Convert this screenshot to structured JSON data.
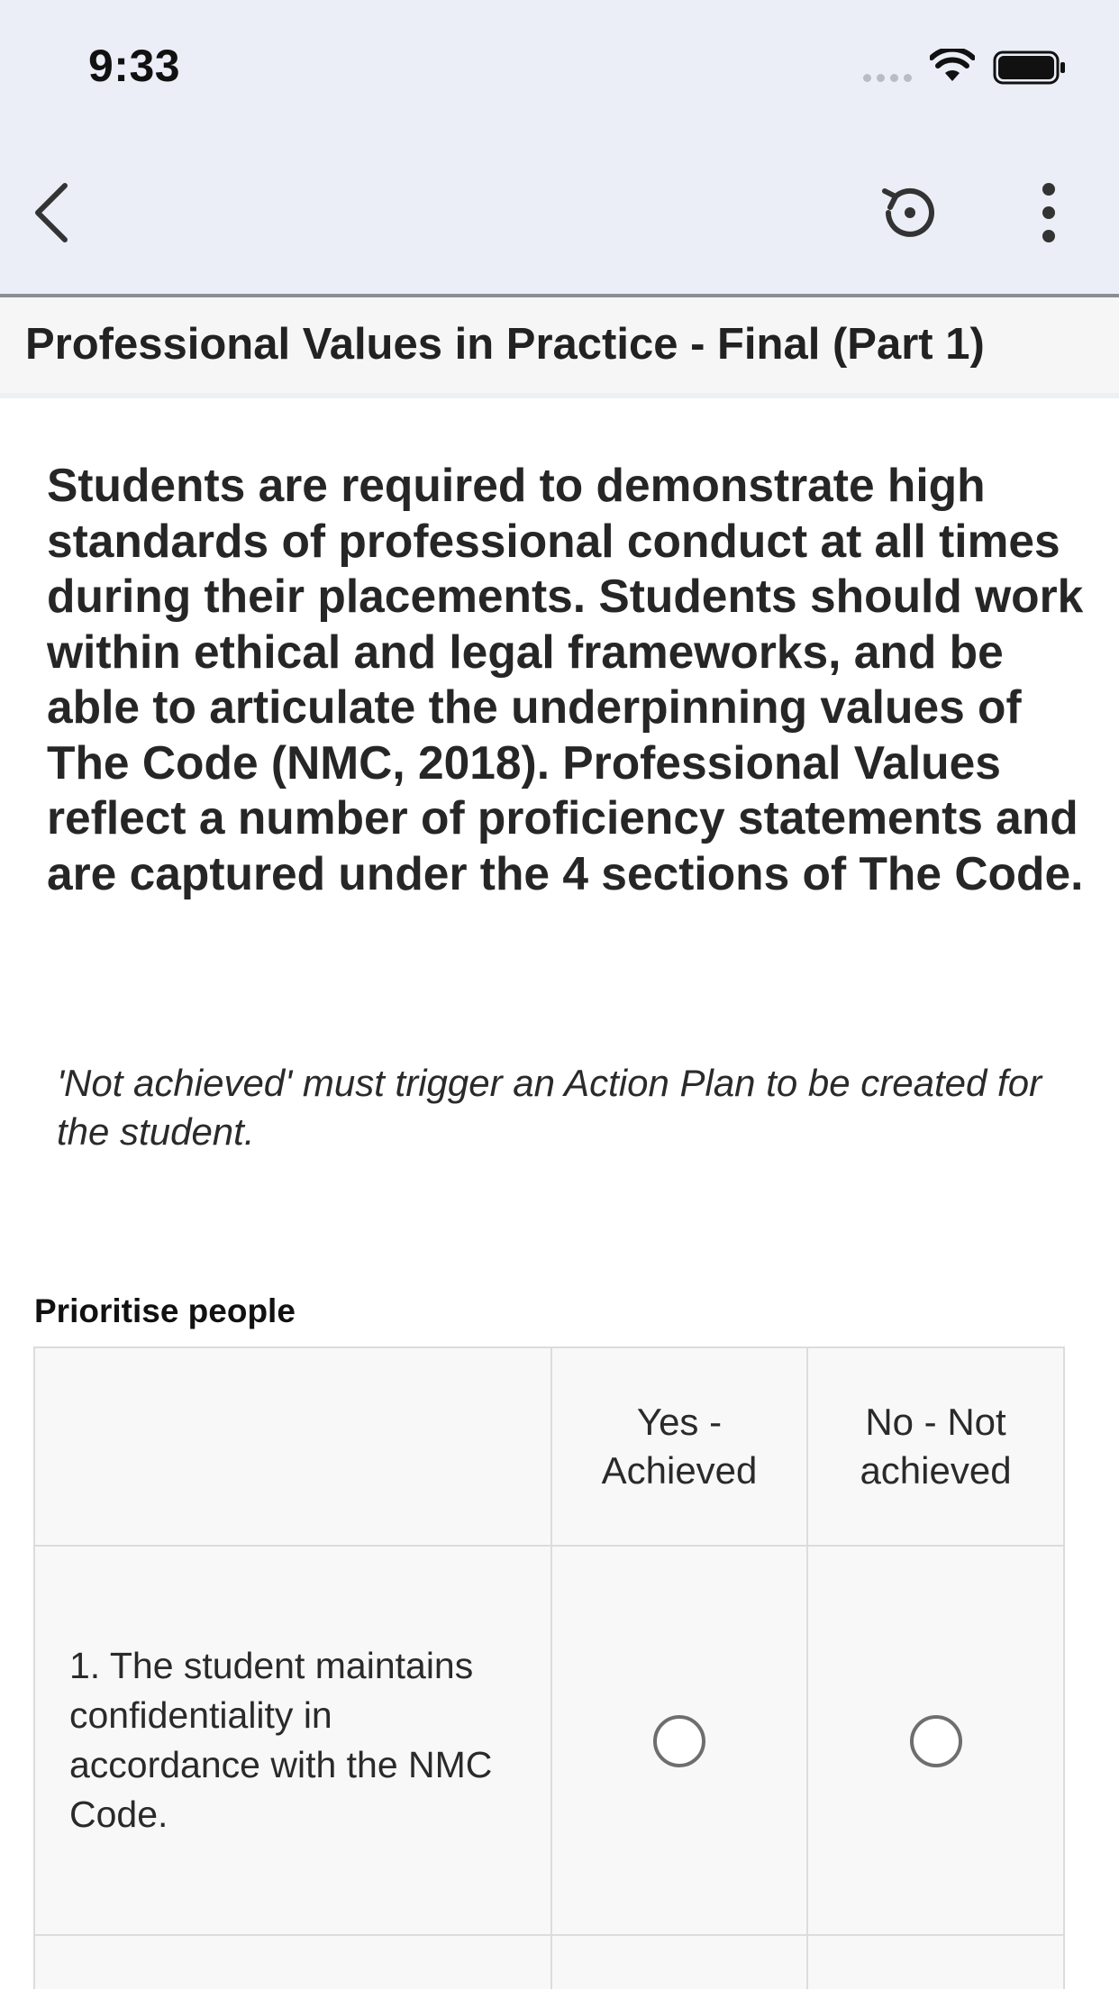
{
  "status_bar": {
    "time": "9:33",
    "icons": [
      "signal-dots-icon",
      "wifi-icon",
      "battery-icon"
    ]
  },
  "app_bar": {
    "icons": [
      "back-chevron-icon",
      "history-icon",
      "more-vert-icon"
    ]
  },
  "section": {
    "title": "Professional Values in Practice - Final (Part 1)"
  },
  "content": {
    "intro": "Students are required to demonstrate high standards of professional conduct at all times during their placements. Students should work within ethical and legal frameworks, and be able to articulate the underpinning values of The Code (NMC, 2018). Professional Values reflect a number of proficiency statements and are captured under the 4 sections of The Code.",
    "note": "'Not achieved' must trigger an Action Plan to be created for the student."
  },
  "assessment": {
    "group_label": "Prioritise people",
    "columns": {
      "yes": "Yes - Achieved",
      "no": "No - Not achieved"
    },
    "rows": [
      {
        "statement": "1. The student maintains confidentiality in accordance with the NMC Code.",
        "yes_selected": false,
        "no_selected": false
      }
    ]
  },
  "colors": {
    "top_background": "#ebeef7",
    "divider": "#8a8d93",
    "table_border": "#dcdcdc",
    "radio_border": "#6e6e6e"
  }
}
